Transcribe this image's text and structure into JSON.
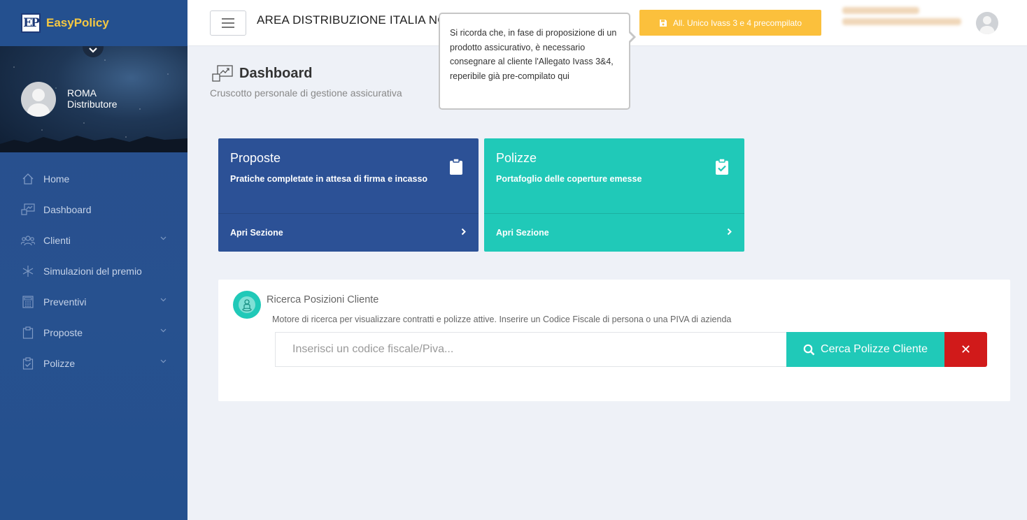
{
  "brand": {
    "logo_text": "EP",
    "name": "EasyPolicy"
  },
  "profile": {
    "name": "ROMA",
    "role": "Distributore"
  },
  "sidebar": {
    "items": [
      {
        "label": "Home",
        "icon": "home-icon",
        "has_submenu": false
      },
      {
        "label": "Dashboard",
        "icon": "dashboard-icon",
        "has_submenu": false
      },
      {
        "label": "Clienti",
        "icon": "users-icon",
        "has_submenu": true
      },
      {
        "label": "Simulazioni del premio",
        "icon": "asterisk-icon",
        "has_submenu": false
      },
      {
        "label": "Preventivi",
        "icon": "calculator-icon",
        "has_submenu": true
      },
      {
        "label": "Proposte",
        "icon": "clipboard-icon",
        "has_submenu": true
      },
      {
        "label": "Polizze",
        "icon": "clipboard-check-icon",
        "has_submenu": true
      }
    ]
  },
  "topbar": {
    "area_title": "AREA DISTRIBUZIONE ITALIA NORD",
    "allegato_button": "All. Unico Ivass 3 e 4 precompilato"
  },
  "tooltip": {
    "text": "Si ricorda che, in fase di proposizione di un prodotto assicurativo, è necessario consegnare al cliente l'Allegato Ivass 3&4, reperibile già pre-compilato qui"
  },
  "page": {
    "title": "Dashboard",
    "subtitle": "Cruscotto personale di gestione assicurativa"
  },
  "cards": [
    {
      "title": "Proposte",
      "description": "Pratiche completate in attesa di firma e incasso",
      "link": "Apri Sezione",
      "color": "#2c5196",
      "icon": "clipboard-icon"
    },
    {
      "title": "Polizze",
      "description": "Portafoglio delle coperture emesse",
      "link": "Apri Sezione",
      "color": "#20c9b8",
      "icon": "clipboard-check-icon"
    }
  ],
  "search": {
    "title": "Ricerca Posizioni Cliente",
    "description": "Motore di ricerca per visualizzare contratti e polizze attive. Inserire un Codice Fiscale di persona o una PIVA di azienda",
    "placeholder": "Inserisci un codice fiscale/Piva...",
    "value": "",
    "search_button": "Cerca Polizze Cliente",
    "clear_button": "✕"
  },
  "colors": {
    "sidebar": "#27518f",
    "accent_teal": "#20c9b8",
    "accent_blue": "#2c5196",
    "warning": "#fbc03c",
    "danger": "#d11a1a",
    "brand_name": "#f5c842"
  }
}
